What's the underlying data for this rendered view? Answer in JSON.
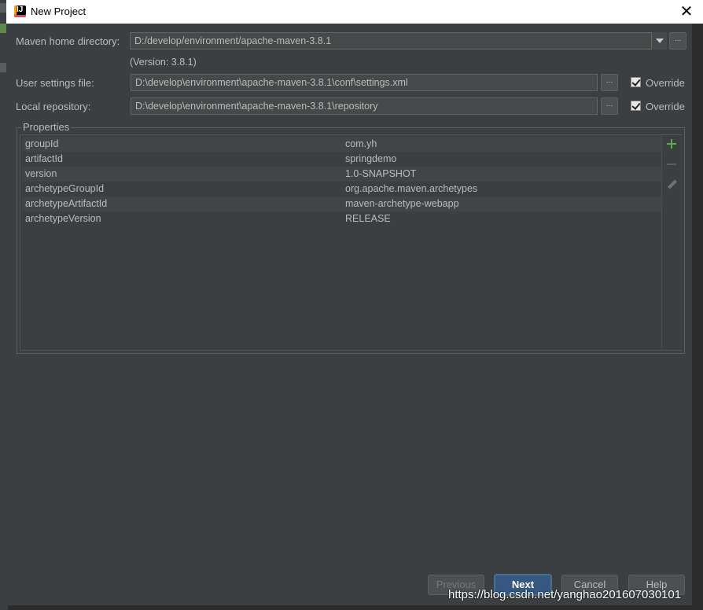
{
  "window": {
    "title": "New Project"
  },
  "form": {
    "maven_home_label": "Maven home directory:",
    "maven_home_value": "D:/develop/environment/apache-maven-3.8.1",
    "version_text": "(Version: 3.8.1)",
    "user_settings_label": "User settings file:",
    "user_settings_value": "D:\\develop\\environment\\apache-maven-3.8.1\\conf\\settings.xml",
    "local_repo_label": "Local repository:",
    "local_repo_value": "D:\\develop\\environment\\apache-maven-3.8.1\\repository",
    "override_label": "Override",
    "browse_label": "..."
  },
  "properties": {
    "group_label": "Properties",
    "rows": [
      {
        "key": "groupId",
        "value": "com.yh"
      },
      {
        "key": "artifactId",
        "value": "springdemo"
      },
      {
        "key": "version",
        "value": "1.0-SNAPSHOT"
      },
      {
        "key": "archetypeGroupId",
        "value": "org.apache.maven.archetypes"
      },
      {
        "key": "archetypeArtifactId",
        "value": "maven-archetype-webapp"
      },
      {
        "key": "archetypeVersion",
        "value": "RELEASE"
      }
    ]
  },
  "buttons": {
    "previous": "Previous",
    "next": "Next",
    "cancel": "Cancel",
    "help": "Help"
  },
  "watermark": "https://blog.csdn.net/yanghao201607030101",
  "colors": {
    "dialog_bg": "#3c3f41",
    "field_bg": "#45494a",
    "primary_button": "#365880",
    "add_icon": "#57b04a"
  }
}
